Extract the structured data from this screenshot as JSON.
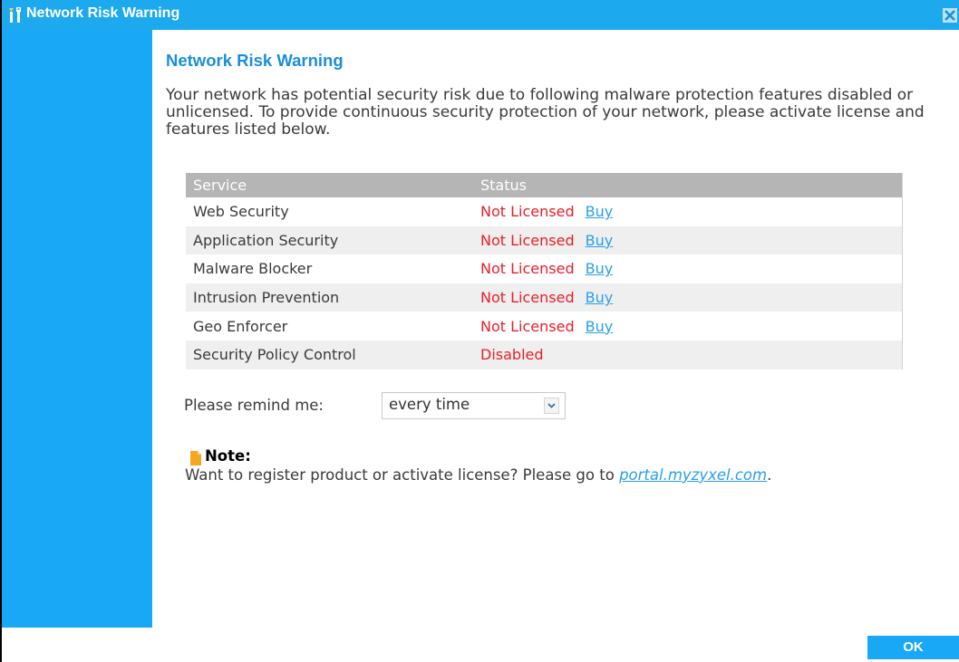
{
  "window": {
    "title": "Network Risk Warning",
    "close_symbol": "×"
  },
  "content": {
    "heading": "Network Risk Warning",
    "intro": "Your network has potential security risk due to following malware protection features disabled or unlicensed. To provide continuous security protection of your network, please activate license and features listed below."
  },
  "table": {
    "headers": [
      "Service",
      "Status"
    ],
    "rows": [
      {
        "service": "Web Security",
        "status": "Not Licensed",
        "action": "Buy"
      },
      {
        "service": "Application Security",
        "status": "Not Licensed",
        "action": "Buy"
      },
      {
        "service": "Malware Blocker",
        "status": "Not Licensed",
        "action": "Buy"
      },
      {
        "service": "Intrusion Prevention",
        "status": "Not Licensed",
        "action": "Buy"
      },
      {
        "service": "Geo Enforcer",
        "status": "Not Licensed",
        "action": "Buy"
      },
      {
        "service": "Security Policy Control",
        "status": "Disabled",
        "action": ""
      }
    ]
  },
  "remind": {
    "label": "Please remind me:",
    "selected": "every time"
  },
  "note": {
    "title": "Note:",
    "text": "Want to register product or activate license? Please go to ",
    "link": "portal.myzyxel.com",
    "suffix": "."
  },
  "footer": {
    "ok_label": "OK"
  },
  "colors": {
    "accent": "#18a8f5",
    "heading": "#1a8fd6",
    "status_red": "#e8202a",
    "link": "#2a9fe8",
    "table_header": "#b5b5b5"
  },
  "icons": {
    "title": "tools-icon",
    "close": "close-icon",
    "dropdown": "chevron-down-icon",
    "note": "note-icon"
  }
}
